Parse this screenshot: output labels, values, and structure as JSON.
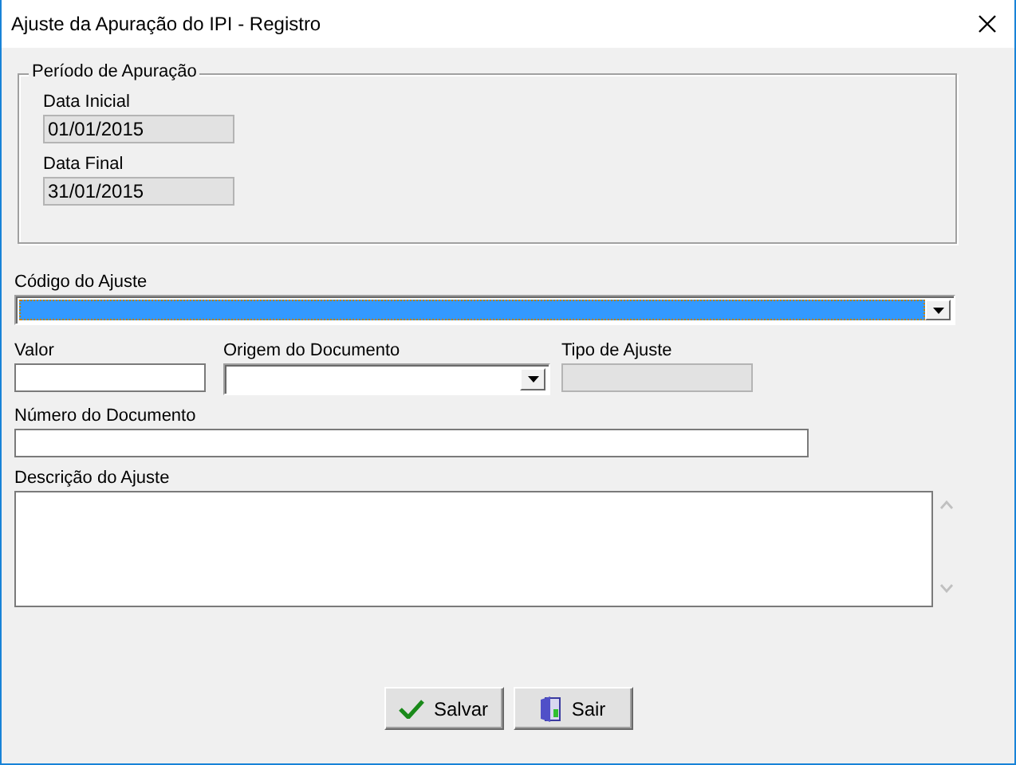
{
  "window": {
    "title": "Ajuste da Apuração do IPI - Registro"
  },
  "period_group": {
    "title": "Período de Apuração",
    "fields": [
      {
        "label": "Data Inicial",
        "value": "01/01/2015",
        "disabled": true
      },
      {
        "label": "Data Final",
        "value": "31/01/2015",
        "disabled": true
      }
    ]
  },
  "rows": [
    [
      {
        "label": "Código do Ajuste",
        "kind": "combo",
        "focused": true,
        "disabled": false
      }
    ],
    [
      {
        "label": "Valor",
        "kind": "text",
        "focused": false,
        "disabled": false
      },
      {
        "label": "Origem do Documento",
        "kind": "combo",
        "focused": false,
        "disabled": false
      },
      {
        "label": "Tipo de Ajuste",
        "kind": "text",
        "focused": false,
        "disabled": true
      }
    ],
    [
      {
        "label": "Número do Documento",
        "kind": "text",
        "focused": false,
        "disabled": false
      }
    ],
    [
      {
        "label": "Descrição do Ajuste",
        "kind": "textarea",
        "focused": false,
        "disabled": false
      }
    ]
  ],
  "buttons": [
    {
      "label": "Salvar",
      "kind": "save"
    },
    {
      "label": "Sair",
      "kind": "exit"
    }
  ]
}
